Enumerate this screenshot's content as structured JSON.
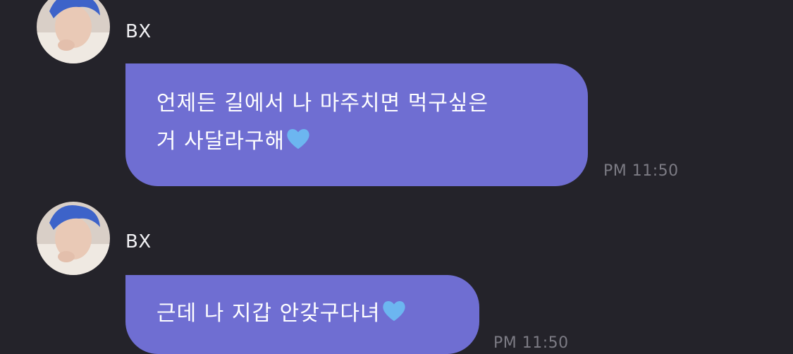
{
  "messages": [
    {
      "sender": "BX",
      "text_line1": "언제든 길에서 나 마주치면 먹구싶은",
      "text_line2": "거 사달라구해",
      "emoji": "blue-heart",
      "time": "PM 11:50"
    },
    {
      "sender": "BX",
      "text_line1": "근데 나 지갑 안갖구다녀",
      "emoji": "blue-heart",
      "time": "PM 11:50"
    }
  ],
  "colors": {
    "background": "#24232a",
    "bubble": "#6f6ed2",
    "heart": "#6cb6f0",
    "timestamp": "#7c7b84"
  }
}
